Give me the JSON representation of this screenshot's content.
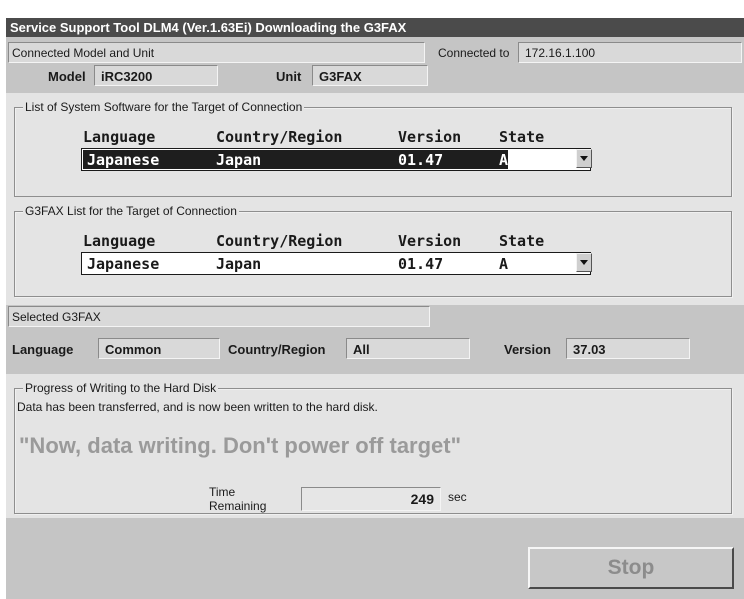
{
  "window": {
    "title": "Service Support Tool DLM4 (Ver.1.63Ei) Downloading the G3FAX"
  },
  "connection": {
    "section_label": "Connected Model and Unit",
    "connected_to_label": "Connected to",
    "connected_to_value": "172.16.1.100",
    "model_label": "Model",
    "model_value": "iRC3200",
    "unit_label": "Unit",
    "unit_value": "G3FAX"
  },
  "system_software": {
    "group_label": "List of System Software for the Target of Connection",
    "headers": {
      "language": "Language",
      "country": "Country/Region",
      "version": "Version",
      "state": "State"
    },
    "row": {
      "language": "Japanese",
      "country": "Japan",
      "version": "01.47",
      "state": "A"
    }
  },
  "g3fax_list": {
    "group_label": "G3FAX List for the Target of Connection",
    "headers": {
      "language": "Language",
      "country": "Country/Region",
      "version": "Version",
      "state": "State"
    },
    "row": {
      "language": "Japanese",
      "country": "Japan",
      "version": "01.47",
      "state": "A"
    }
  },
  "selected": {
    "section_label": "Selected G3FAX",
    "language_label": "Language",
    "language_value": "Common",
    "country_label": "Country/Region",
    "country_value": "All",
    "version_label": "Version",
    "version_value": "37.03"
  },
  "progress": {
    "group_label": "Progress of Writing to the Hard Disk",
    "message": "Data has been transferred, and is now been written to the hard disk.",
    "warning": "\"Now, data writing. Don't power off target\"",
    "time_label": "Time Remaining",
    "time_value": "249",
    "time_unit": "sec"
  },
  "buttons": {
    "stop_label": "Stop"
  },
  "icons": {
    "dropdown": "chevron-down-icon"
  }
}
